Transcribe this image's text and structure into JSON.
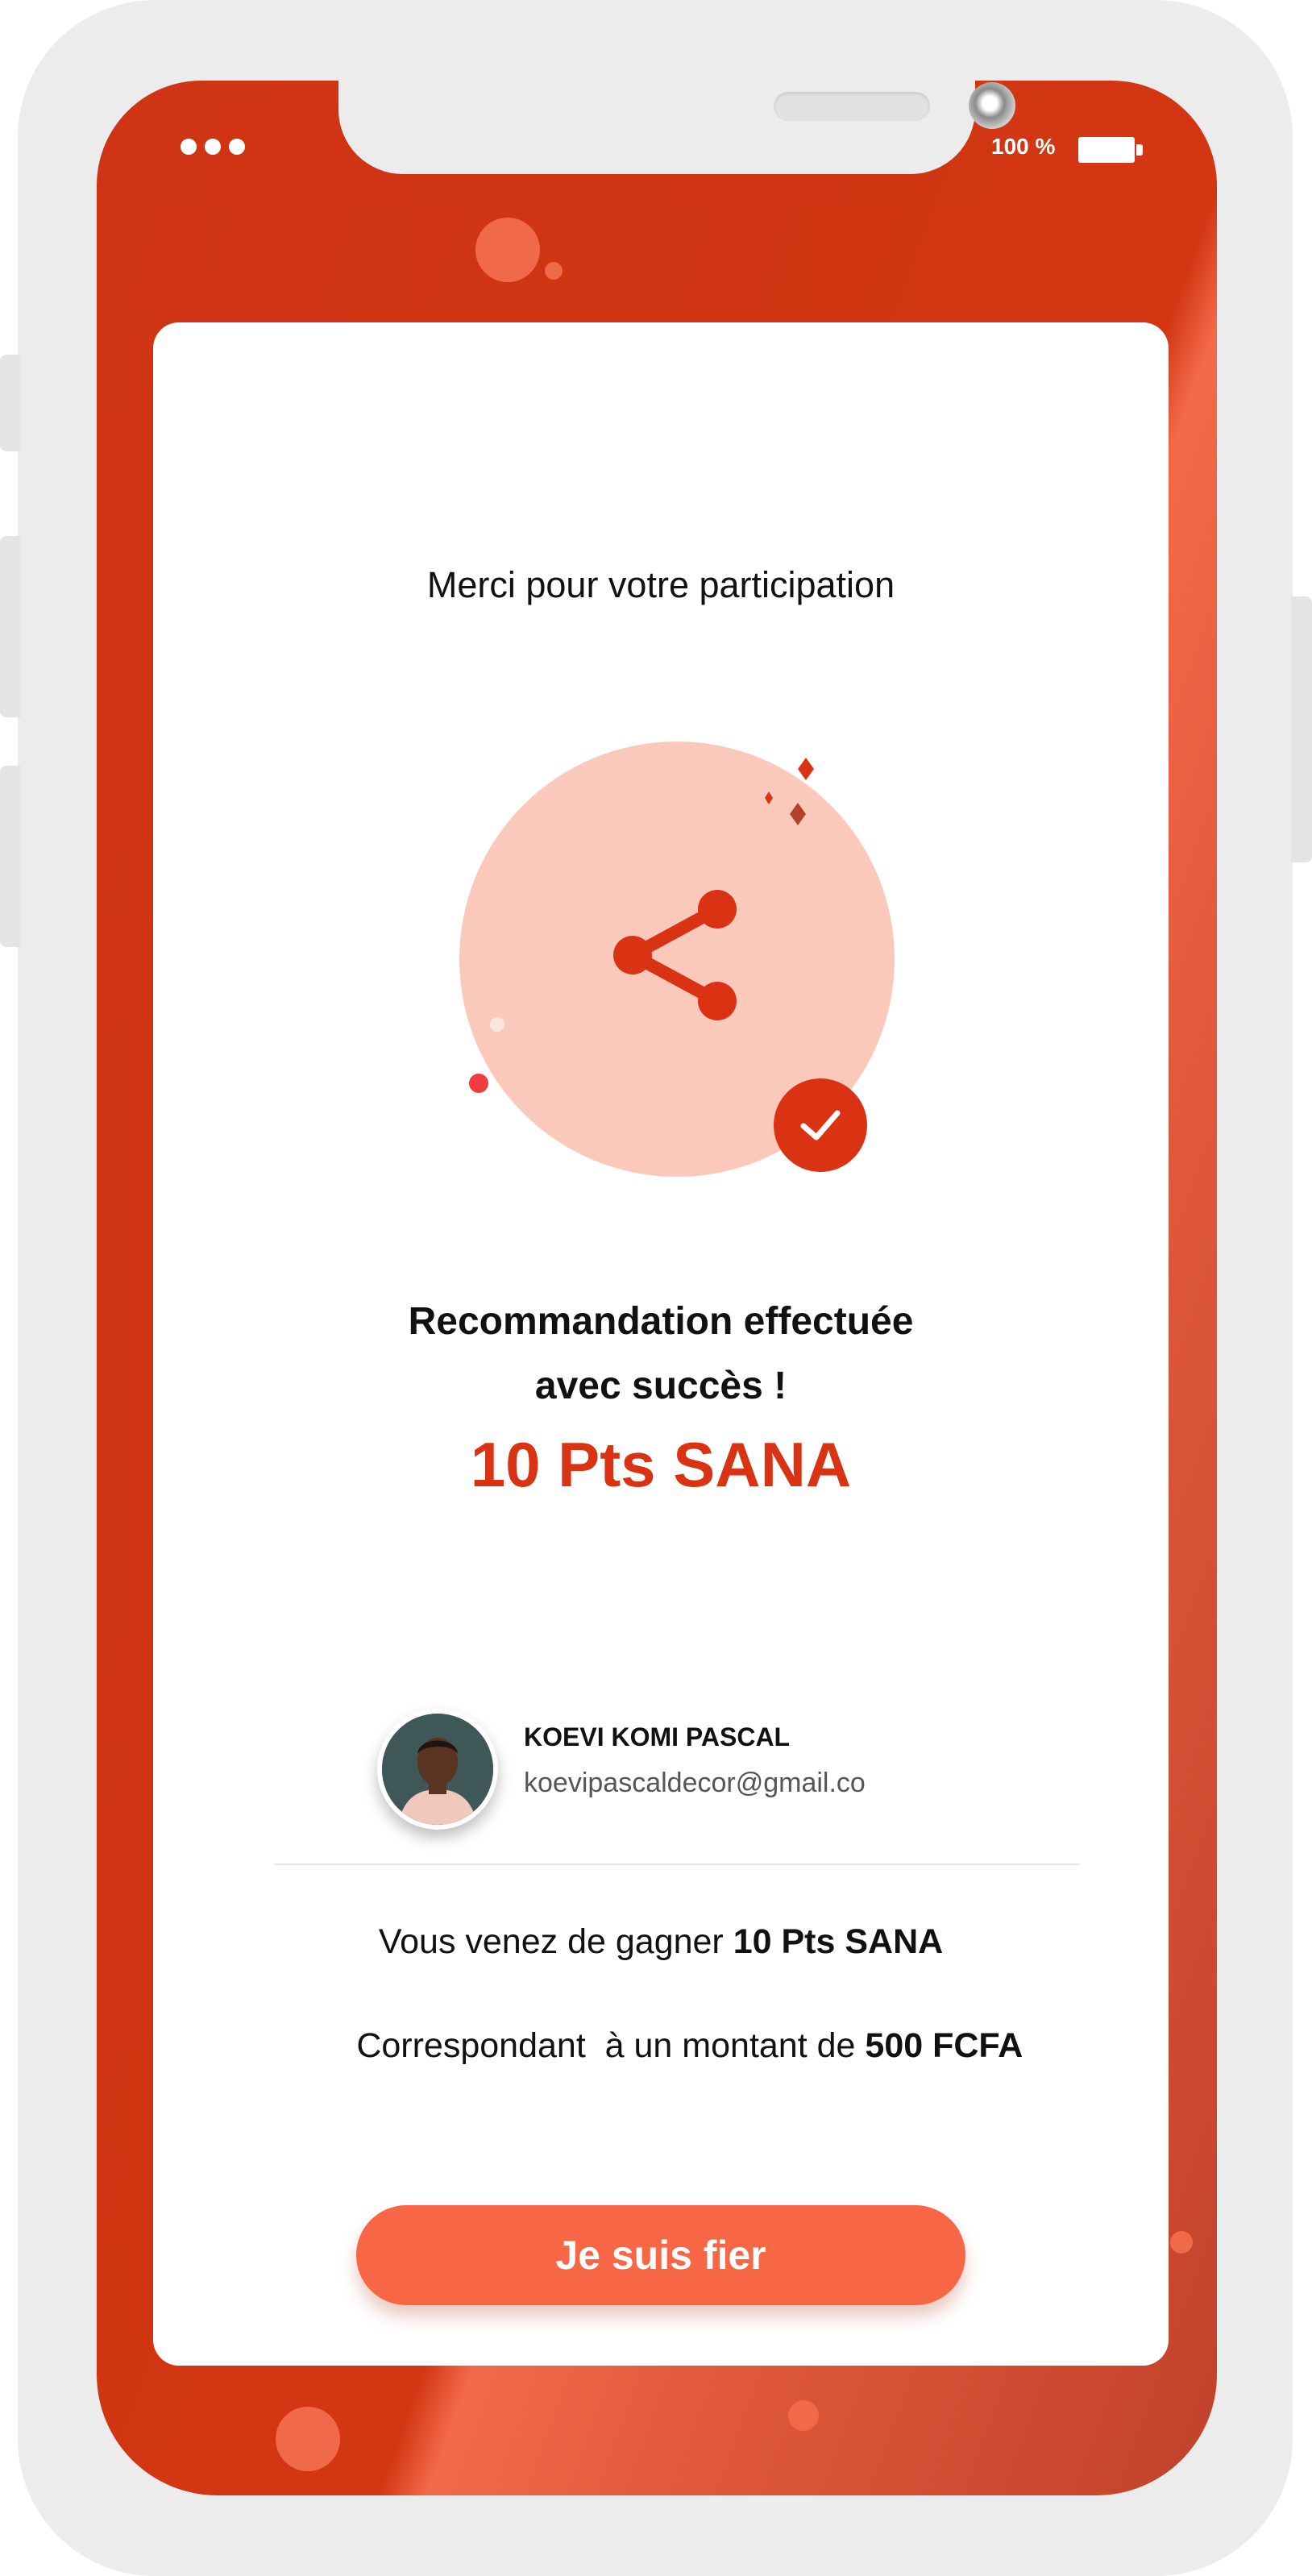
{
  "status_bar": {
    "battery": "100 %"
  },
  "header": {
    "title": "Merci pour votre participation"
  },
  "success": {
    "title_line1": "Recommandation effectuée",
    "title_line2": "avec succès !",
    "points": "10 Pts SANA"
  },
  "user": {
    "name": "KOEVI KOMI PASCAL",
    "email": "koevipascaldecor@gmail.co"
  },
  "reward": {
    "line1_prefix": "Vous venez de gagner ",
    "line1_value": "10 Pts SANA",
    "line2_prefix": "Correspondant  à un montant de ",
    "line2_value": "500 FCFA"
  },
  "cta": {
    "label": "Je suis fier"
  },
  "colors": {
    "primary": "#d93314",
    "button": "#f76645",
    "illustration_bg": "#fbc9bb"
  },
  "icons": [
    "share-icon",
    "check-icon",
    "battery-icon"
  ]
}
